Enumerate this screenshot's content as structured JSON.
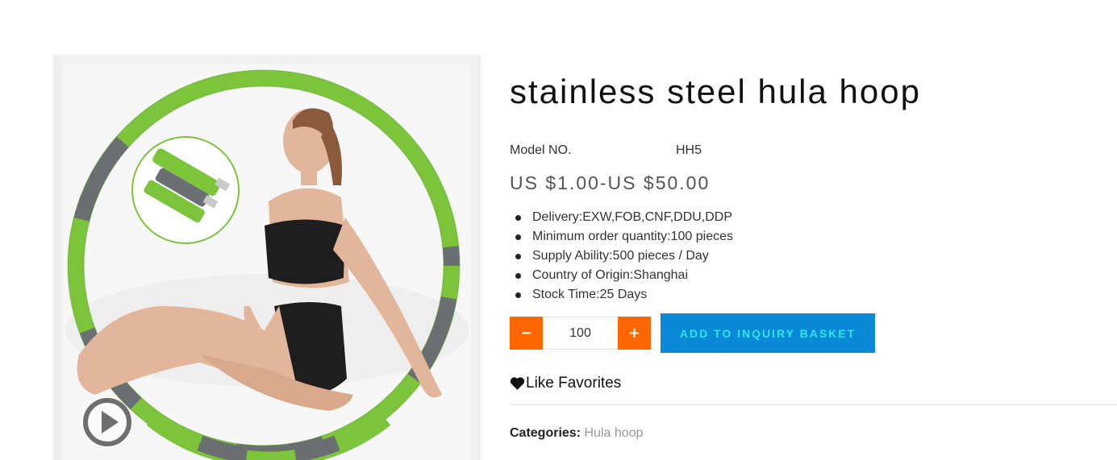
{
  "product": {
    "title": "stainless steel hula hoop",
    "model_label": "Model NO.",
    "model_value": "HH5",
    "price": "US $1.00-US $50.00",
    "features": [
      "Delivery:EXW,FOB,CNF,DDU,DDP",
      "Minimum order quantity:100 pieces",
      "Supply Ability:500 pieces / Day",
      "Country of Origin:Shanghai",
      "Stock Time:25 Days"
    ]
  },
  "quantity": {
    "minus": "−",
    "value": "100",
    "plus": "+"
  },
  "actions": {
    "inquiry_label": "ADD TO INQUIRY BASKET",
    "favorites_label": "Like Favorites"
  },
  "categories": {
    "label": "Categories:",
    "value": "Hula hoop"
  },
  "icons": {
    "play": "play-circle-icon",
    "heart": "heart-icon"
  },
  "colors": {
    "accent_orange": "#ff6600",
    "button_blue": "#0a8ad6",
    "button_text": "#2fe3f0",
    "hoop_green": "#7cc43a",
    "hoop_grey": "#6b6f72"
  }
}
